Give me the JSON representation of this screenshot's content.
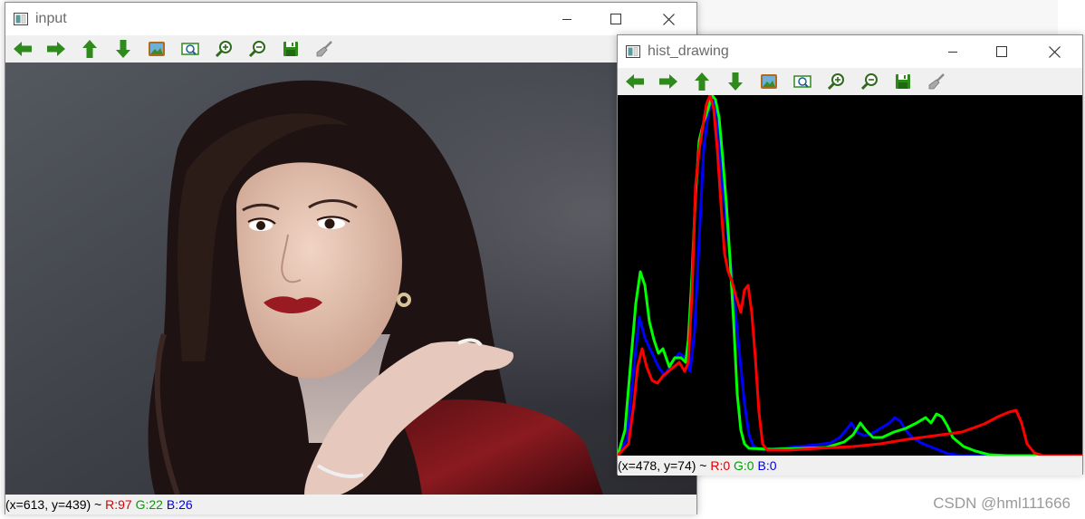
{
  "windows": {
    "input": {
      "title": "input",
      "status": {
        "coords": "(x=613, y=439) ~ ",
        "r": "R:97",
        "g": "G:22",
        "b": "B:26"
      }
    },
    "hist": {
      "title": "hist_drawing",
      "status": {
        "coords": "(x=478, y=74) ~ ",
        "r": "R:0",
        "g": "G:0",
        "b": "B:0"
      }
    }
  },
  "toolbar_icons": [
    "arrow-left-icon",
    "arrow-right-icon",
    "arrow-up-icon",
    "arrow-down-icon",
    "image-icon",
    "zoom-fit-icon",
    "zoom-in-icon",
    "zoom-out-icon",
    "save-icon",
    "brush-icon"
  ],
  "colors": {
    "hist_background": "#000000",
    "blue_channel": "#0000ff",
    "green_channel": "#00ff00",
    "red_channel": "#ff0000"
  },
  "watermark": "CSDN @hml111666"
}
